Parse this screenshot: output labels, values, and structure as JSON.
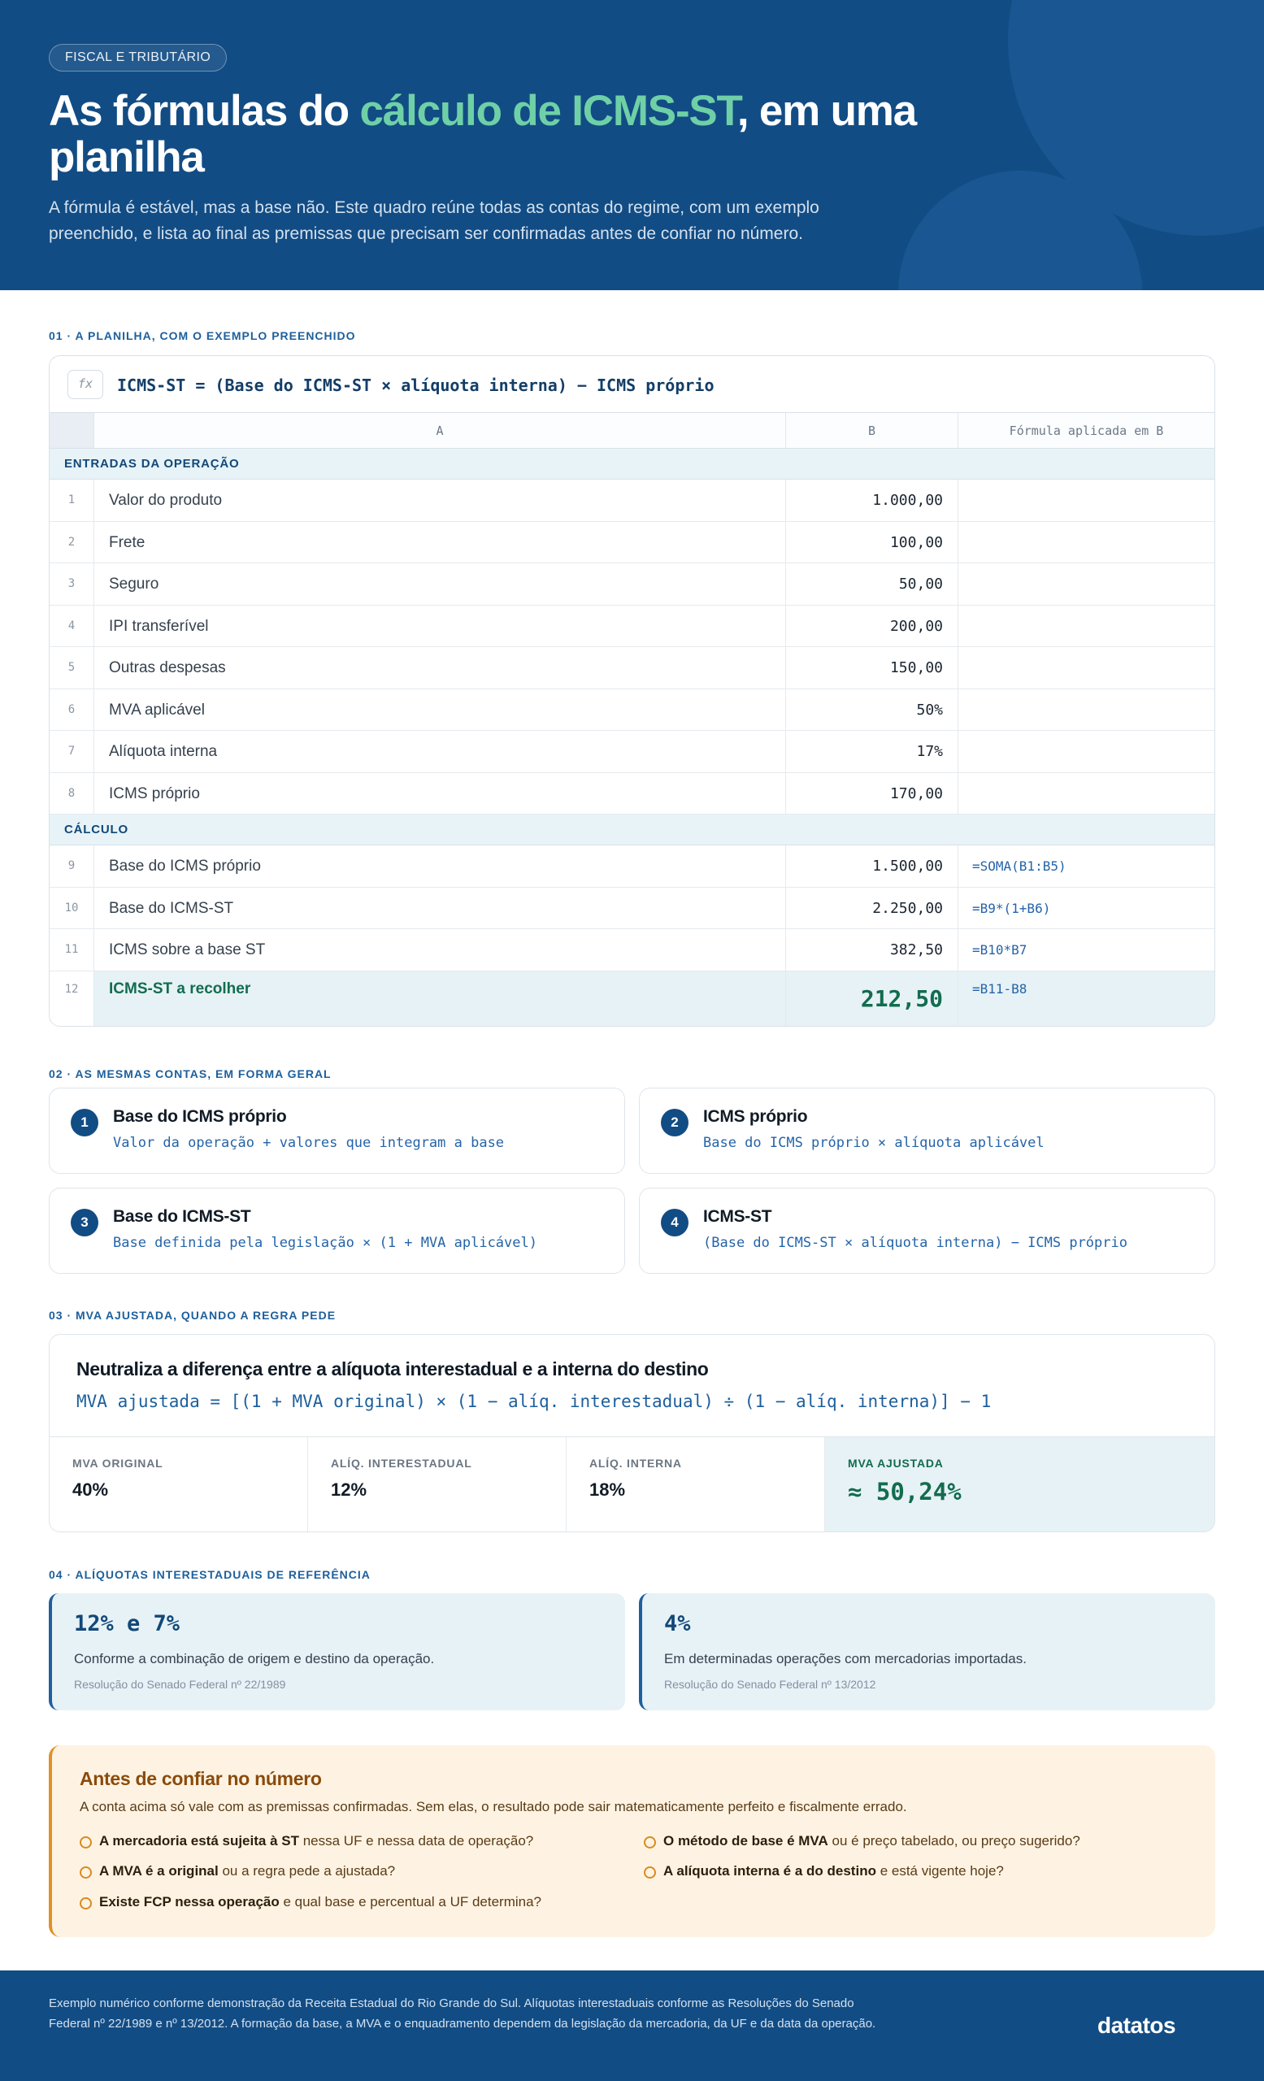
{
  "hero": {
    "tag": "FISCAL E TRIBUTÁRIO",
    "title_pre": "As fórmulas do ",
    "title_highlight": "cálculo de ICMS-ST",
    "title_post": ", em uma planilha",
    "subtitle": "A fórmula é estável, mas a base não. Este quadro reúne todas as contas do regime, com um exemplo preenchido, e lista ao final as premissas que precisam ser confirmadas antes de confiar no número."
  },
  "section1": {
    "heading": "01 · A PLANILHA, COM O EXEMPLO PREENCHIDO",
    "fx_icon": "fx",
    "formula_bar": "ICMS-ST = (Base do ICMS-ST × alíquota interna) − ICMS próprio",
    "col_a": "A",
    "col_b": "B",
    "col_f": "Fórmula aplicada em B",
    "group1": "ENTRADAS DA OPERAÇÃO",
    "group2": "CÁLCULO",
    "rows": [
      {
        "n": "1",
        "a": "Valor do produto",
        "b": "1.000,00",
        "f": ""
      },
      {
        "n": "2",
        "a": "Frete",
        "b": "100,00",
        "f": ""
      },
      {
        "n": "3",
        "a": "Seguro",
        "b": "50,00",
        "f": ""
      },
      {
        "n": "4",
        "a": "IPI transferível",
        "b": "200,00",
        "f": ""
      },
      {
        "n": "5",
        "a": "Outras despesas",
        "b": "150,00",
        "f": ""
      },
      {
        "n": "6",
        "a": "MVA aplicável",
        "b": "50%",
        "f": ""
      },
      {
        "n": "7",
        "a": "Alíquota interna",
        "b": "17%",
        "f": ""
      },
      {
        "n": "8",
        "a": "ICMS próprio",
        "b": "170,00",
        "f": ""
      },
      {
        "n": "9",
        "a": "Base do ICMS próprio",
        "b": "1.500,00",
        "f": "=SOMA(B1:B5)"
      },
      {
        "n": "10",
        "a": "Base do ICMS-ST",
        "b": "2.250,00",
        "f": "=B9*(1+B6)"
      },
      {
        "n": "11",
        "a": "ICMS sobre a base ST",
        "b": "382,50",
        "f": "=B10*B7"
      },
      {
        "n": "12",
        "a": "ICMS-ST a recolher",
        "b": "212,50",
        "f": "=B11-B8"
      }
    ]
  },
  "section2": {
    "heading": "02 · AS MESMAS CONTAS, EM FORMA GERAL",
    "cards": [
      {
        "num": "1",
        "title": "Base do ICMS próprio",
        "formula": "Valor da operação + valores que integram a base"
      },
      {
        "num": "2",
        "title": "ICMS próprio",
        "formula": "Base do ICMS próprio × alíquota aplicável"
      },
      {
        "num": "3",
        "title": "Base do ICMS-ST",
        "formula": "Base definida pela legislação × (1 + MVA aplicável)"
      },
      {
        "num": "4",
        "title": "ICMS-ST",
        "formula": "(Base do ICMS-ST × alíquota interna) − ICMS próprio"
      }
    ]
  },
  "section3": {
    "heading": "03 · MVA AJUSTADA, QUANDO A REGRA PEDE",
    "title": "Neutraliza a diferença entre a alíquota interestadual e a interna do destino",
    "formula": "MVA ajustada = [(1 + MVA original) × (1 − alíq. interestadual) ÷ (1 − alíq. interna)] − 1",
    "cells": [
      {
        "label": "MVA ORIGINAL",
        "value": "40%"
      },
      {
        "label": "ALÍQ. INTERESTADUAL",
        "value": "12%"
      },
      {
        "label": "ALÍQ. INTERNA",
        "value": "18%"
      }
    ],
    "result_label": "MVA AJUSTADA",
    "result_value": "≈ 50,24%"
  },
  "section4": {
    "heading": "04 · ALÍQUOTAS INTERESTADUAIS DE REFERÊNCIA",
    "cards": [
      {
        "value": "12% e 7%",
        "desc": "Conforme a combinação de origem e destino da operação.",
        "source": "Resolução do Senado Federal nº 22/1989"
      },
      {
        "value": "4%",
        "desc": "Em determinadas operações com mercadorias importadas.",
        "source": "Resolução do Senado Federal nº 13/2012"
      }
    ]
  },
  "warning": {
    "title": "Antes de confiar no número",
    "intro": "A conta acima só vale com as premissas confirmadas. Sem elas, o resultado pode sair matematicamente perfeito e fiscalmente errado.",
    "items": [
      {
        "bold": "A mercadoria está sujeita à ST",
        "rest": " nessa UF e nessa data de operação?"
      },
      {
        "bold": "O método de base é MVA",
        "rest": " ou é preço tabelado, ou preço sugerido?"
      },
      {
        "bold": "A MVA é a original",
        "rest": " ou a regra pede a ajustada?"
      },
      {
        "bold": "A alíquota interna é a do destino",
        "rest": " e está vigente hoje?"
      },
      {
        "bold": "Existe FCP nessa operação",
        "rest": " e qual base e percentual a UF determina?"
      }
    ]
  },
  "footer": {
    "text": "Exemplo numérico conforme demonstração da Receita Estadual do Rio Grande do Sul. Alíquotas interestaduais conforme as Resoluções do Senado Federal nº 22/1989 e nº 13/2012. A formação da base, a MVA e o enquadramento dependem da legislação da mercadoria, da UF e da data da operação.",
    "logo": "datatos"
  },
  "colors": {
    "brand_blue": "#124c84",
    "accent_green": "#6fd0a7",
    "result_green": "#136c4e",
    "formula_blue": "#2564a8",
    "warning_orange": "#e09126"
  }
}
